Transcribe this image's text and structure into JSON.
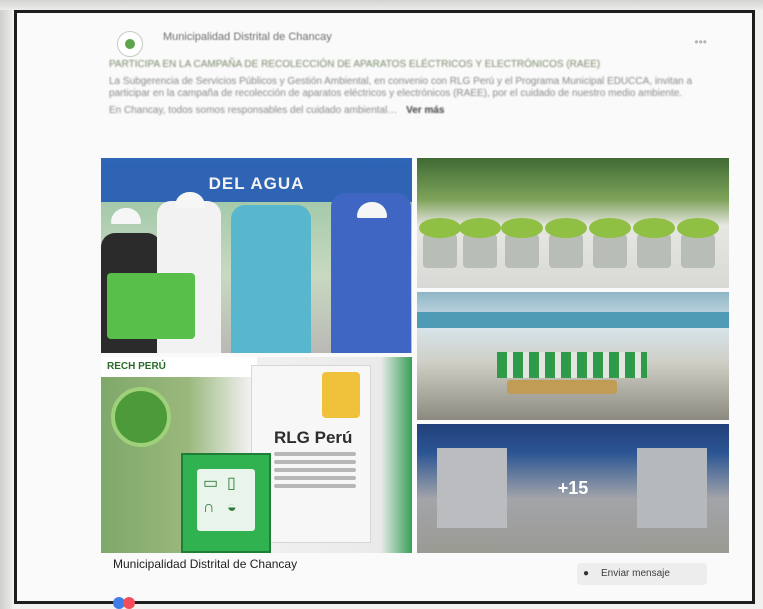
{
  "header": {
    "page_name": "Municipalidad Distrital de Chancay",
    "post_meta": "",
    "more_icon": "more-icon"
  },
  "post": {
    "headline": "PARTICIPA EN LA CAMPAÑA DE RECOLECCIÓN DE APARATOS ELÉCTRICOS Y ELECTRÓNICOS (RAEE)",
    "body": "La Subgerencia de Servicios Públicos y Gestión Ambiental, en convenio con RLG Perú y el Programa Municipal EDUCCA, invitan a participar en la campaña de recolección de aparatos eléctricos y electrónicos (RAEE), por el cuidado de nuestro medio ambiente.",
    "footer_line": "En Chancay, todos somos responsables del cuidado ambiental…",
    "see_more": "Ver más"
  },
  "media": {
    "banner_text": "DEL AGUA",
    "rlg_title": "RLG Perú",
    "brand_strip": "RECH PERÚ",
    "more_count": "+15"
  },
  "footer": {
    "page_name": "Municipalidad Distrital de Chancay",
    "subtitle": "",
    "message_button": "Enviar mensaje",
    "message_icon": "messenger-icon"
  },
  "colors": {
    "accent": "#3b8d2c",
    "frame": "#1d1d1d",
    "banner": "#2f63b3"
  }
}
